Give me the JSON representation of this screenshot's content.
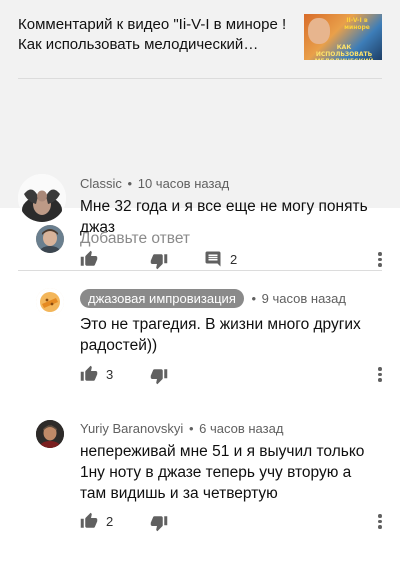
{
  "header": {
    "title": "Комментарий к видео \"Ii-V-I в миноре ! Как использовать мелодический минор\"",
    "thumbnail_caption_top": "II-V-I в миноре",
    "thumbnail_caption_bottom": "КАК ИСПОЛЬЗОВАТЬ МЕЛОДИЧЕСКИЙ МИНОР"
  },
  "main_comment": {
    "author": "Classic",
    "time": "10 часов назад",
    "text": "Мне 32 года и я все еще не могу понять джаз",
    "reply_count": "2"
  },
  "reply_box": {
    "placeholder": "Добавьте ответ"
  },
  "replies": [
    {
      "author": "джазовая импровизация",
      "time": "9 часов назад",
      "text": "Это не трагедия. В жизни много других радостей))",
      "likes": "3"
    },
    {
      "author": "Yuriy Baranovskyi",
      "time": "6 часов назад",
      "text": "непереживай мне 51 и я выучил только 1ну ноту в джазе теперь учу вторую а там видишь и за четвертую",
      "likes": "2"
    }
  ],
  "meta_separator": "•",
  "icons": {
    "like": "thumb-up-icon",
    "dislike": "thumb-down-icon",
    "reply": "comment-icon",
    "more": "more-vert-icon"
  },
  "colors": {
    "top_background": "#f2f2f2",
    "badge_background": "#8a8a8a",
    "secondary_text": "#606060"
  }
}
